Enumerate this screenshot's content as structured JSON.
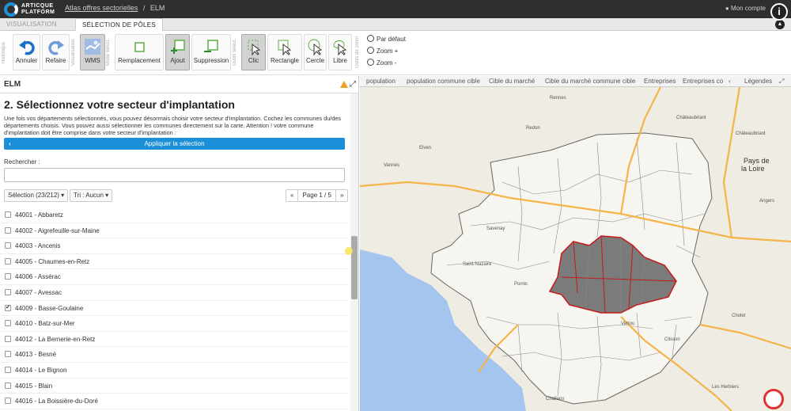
{
  "header": {
    "logo_line1": "ARTICQUE",
    "logo_line2": "PLATFORM",
    "breadcrumb_link": "Atlas offres sectorielles",
    "breadcrumb_sep": "/",
    "breadcrumb_current": "ELM",
    "user": "Mon compte",
    "info_icon": "i"
  },
  "tabs": [
    {
      "label": "VISUALISATION",
      "active": false
    },
    {
      "label": "SÉLECTION DE PÔLES",
      "active": true
    }
  ],
  "toolbar": {
    "groups": [
      "Historique",
      "Visualisation",
      "Mode sélect.",
      "Outils sélect.",
      "Outils de zoom"
    ],
    "undo": "Annuler",
    "redo": "Refaire",
    "wms": "WMS",
    "replace": "Remplacement",
    "add": "Ajout",
    "remove": "Suppression",
    "click": "Clic",
    "rect": "Rectangle",
    "circle": "Cercle",
    "free": "Libre",
    "zoom_default": "Par défaut",
    "zoom_in": "Zoom +",
    "zoom_out": "Zoom -"
  },
  "panel": {
    "title": "ELM",
    "heading": "2. Sélectionnez votre secteur d'implantation",
    "description": "Une fois vos départements sélectionnés, vous pouvez désormais choisir votre secteur d'implantation. Cochez les communes du/des départements choisis. Vous pouvez aussi sélectionner les communes directement sur la carte. Attention ! votre commune d'implantation doit être comprise dans votre secteur d'implantation :",
    "apply_button": "Appliquer la sélection",
    "search_label": "Rechercher :",
    "search_value": "",
    "selection_dropdown": "Sélection (23/212) ▾",
    "sort_dropdown": "Tri : Aucun ▾",
    "pager_prev": "«",
    "pager_label": "Page 1 / 5",
    "pager_next": "»"
  },
  "communes": [
    {
      "label": "44001 - Abbaretz",
      "checked": false
    },
    {
      "label": "44002 - Aigrefeuille-sur-Maine",
      "checked": false
    },
    {
      "label": "44003 - Ancenis",
      "checked": false
    },
    {
      "label": "44005 - Chaumes-en-Retz",
      "checked": false
    },
    {
      "label": "44006 - Assérac",
      "checked": false
    },
    {
      "label": "44007 - Avessac",
      "checked": false
    },
    {
      "label": "44009 - Basse-Goulaine",
      "checked": true
    },
    {
      "label": "44010 - Batz-sur-Mer",
      "checked": false
    },
    {
      "label": "44012 - La Bernerie-en-Retz",
      "checked": false
    },
    {
      "label": "44013 - Besné",
      "checked": false
    },
    {
      "label": "44014 - Le Bignon",
      "checked": false
    },
    {
      "label": "44015 - Blain",
      "checked": false
    },
    {
      "label": "44016 - La Boissière-du-Doré",
      "checked": false
    }
  ],
  "map": {
    "layers": [
      "population",
      "population commune cible",
      "Cible du marché",
      "Cible du marché commune cible",
      "Entreprises",
      "Entreprises co"
    ],
    "layers_nav": "‹",
    "legend_tab": "Légendes",
    "region_label_1": "Pays de",
    "region_label_2": "la Loire",
    "towns": [
      "Redon",
      "Vannes",
      "Elven",
      "Savenay",
      "Rennes",
      "Châteaubriant",
      "Châteaubriant",
      "Angers",
      "Cholet",
      "Challans",
      "Les Herbiers",
      "Pornic",
      "Clisson",
      "Saint-Nazaire",
      "Vertou"
    ],
    "colors": {
      "sea": "#a4c6ee",
      "land": "#efece4",
      "selected": "#7b7b7b",
      "selected_border": "#c41a1a",
      "road": "#f4b448"
    }
  }
}
